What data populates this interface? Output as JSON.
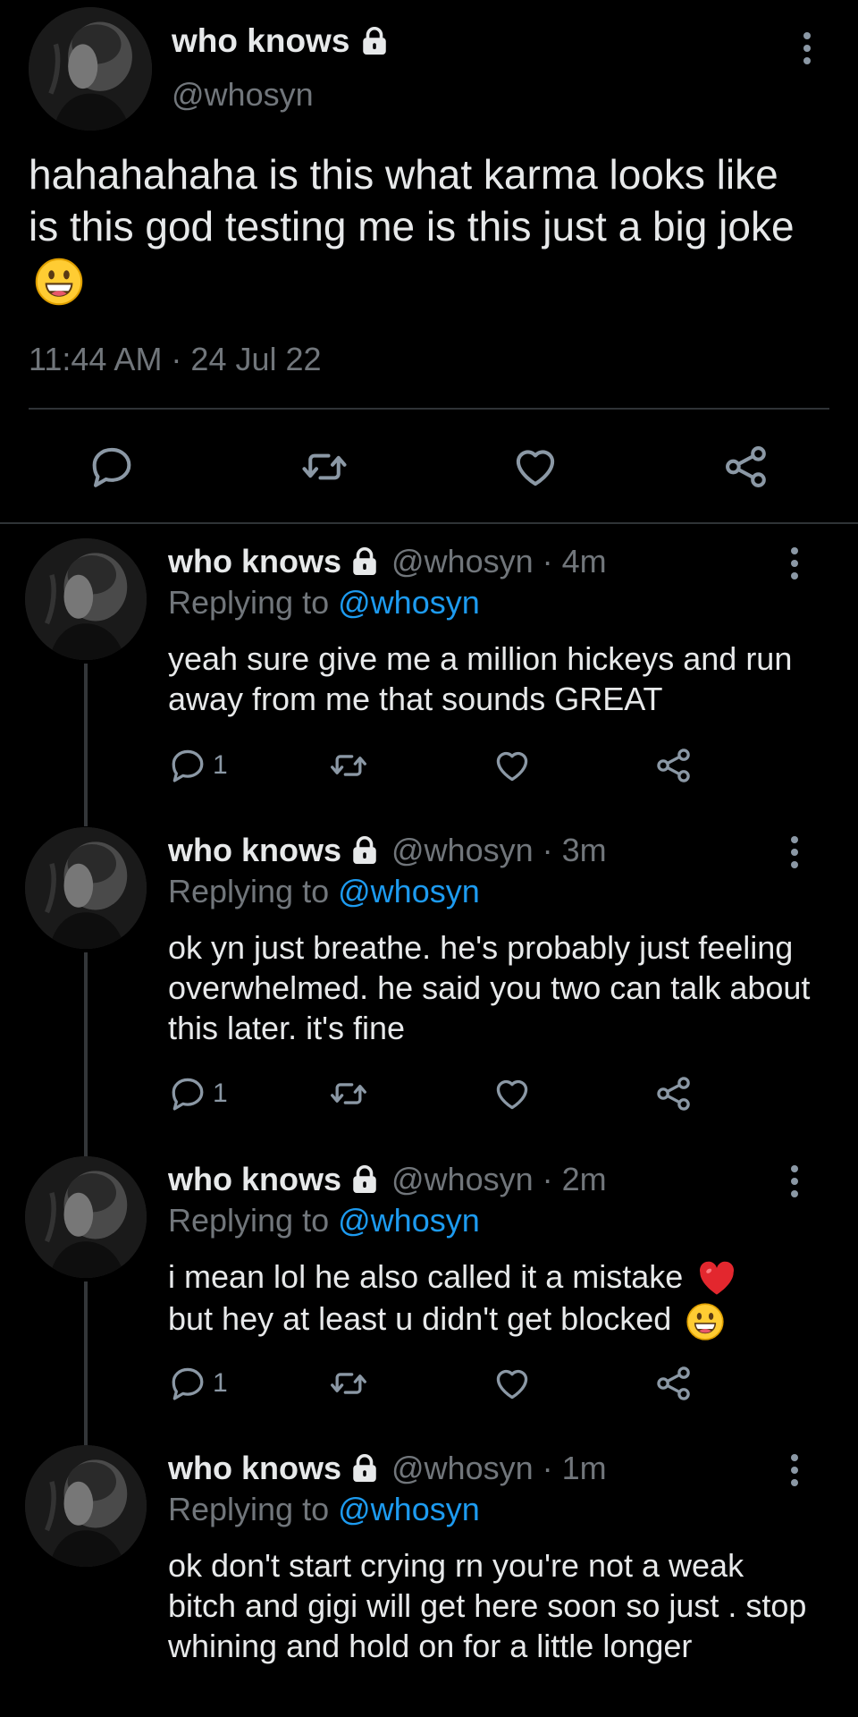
{
  "main_tweet": {
    "display_name": "who knows",
    "handle": "@whosyn",
    "text": "hahahahaha is this what karma looks like is this god testing me is this just a big joke",
    "emoji": "grinning-face",
    "timestamp": "11:44 AM · 24 Jul 22"
  },
  "replies": [
    {
      "display_name": "who knows",
      "handle_time": "@whosyn · 4m",
      "replying_label": "Replying to",
      "replying_mention": "@whosyn",
      "text": "yeah sure give me a million hickeys and run away from me that sounds GREAT",
      "reply_count": "1"
    },
    {
      "display_name": "who knows",
      "handle_time": "@whosyn · 3m",
      "replying_label": "Replying to",
      "replying_mention": "@whosyn",
      "text": "ok yn just breathe. he's probably just feeling overwhelmed. he said you two can talk about this later. it's fine",
      "reply_count": "1"
    },
    {
      "display_name": "who knows",
      "handle_time": "@whosyn · 2m",
      "replying_label": "Replying to",
      "replying_mention": "@whosyn",
      "text_part1": "i mean lol he also called it a mistake",
      "text_part2": "but hey at least u didn't get blocked",
      "reply_count": "1"
    },
    {
      "display_name": "who knows",
      "handle_time": "@whosyn · 1m",
      "replying_label": "Replying to",
      "replying_mention": "@whosyn",
      "text": "ok don't start crying rn you're not a weak bitch and gigi will get here soon so just . stop whining and hold on for a little longer"
    }
  ],
  "icons": {
    "lock": "lock-icon",
    "more": "more-vertical-icon",
    "reply": "reply-icon",
    "retweet": "retweet-icon",
    "like": "heart-icon",
    "share": "share-icon",
    "heart_emoji": "red-heart-emoji",
    "grin_emoji": "grinning-face-emoji"
  },
  "colors": {
    "background": "#000000",
    "primary_text": "#E7E9EA",
    "secondary_text": "#71767B",
    "link": "#1D9BF0",
    "icon": "#8B98A5",
    "divider": "#2F3336"
  }
}
